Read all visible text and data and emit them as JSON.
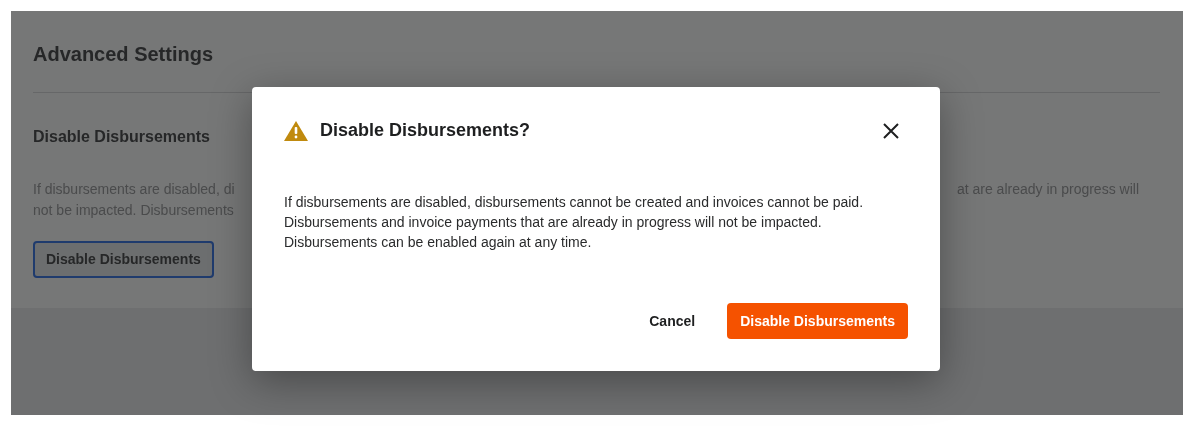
{
  "background": {
    "title": "Advanced Settings",
    "section_title": "Disable Disbursements",
    "description_left": [
      "If disbursements are disabled, di",
      "not be impacted. Disbursements"
    ],
    "description_right": "at are already in progress will",
    "button": "Disable Disbursements"
  },
  "modal": {
    "title": "Disable Disbursements?",
    "body": "If disbursements are disabled, disbursements cannot be created and invoices cannot be paid. Disbursements and invoice payments that are already in progress will not be impacted. Disbursements can be enabled again at any time.",
    "cancel": "Cancel",
    "confirm": "Disable Disbursements"
  }
}
